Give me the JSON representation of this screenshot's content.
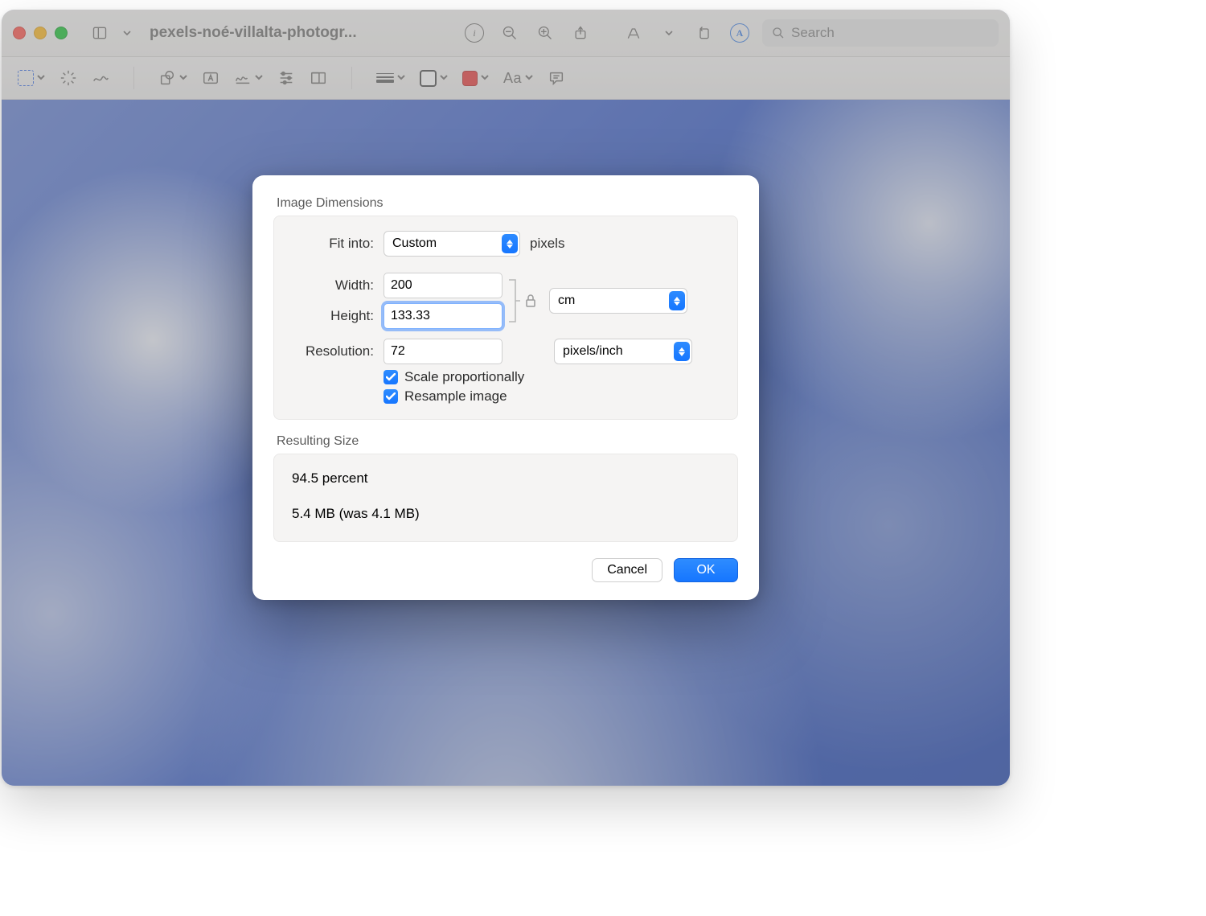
{
  "window": {
    "title": "pexels-noé-villalta-photogr...",
    "search_placeholder": "Search"
  },
  "dialog": {
    "section1_title": "Image Dimensions",
    "fit_into_label": "Fit into:",
    "fit_into_value": "Custom",
    "fit_into_unit": "pixels",
    "width_label": "Width:",
    "width_value": "200",
    "height_label": "Height:",
    "height_value": "133.33",
    "size_unit_value": "cm",
    "resolution_label": "Resolution:",
    "resolution_value": "72",
    "resolution_unit_value": "pixels/inch",
    "scale_label": "Scale proportionally",
    "resample_label": "Resample image",
    "section2_title": "Resulting Size",
    "result_percent": "94.5 percent",
    "result_size": "5.4 MB (was 4.1 MB)",
    "cancel": "Cancel",
    "ok": "OK"
  }
}
